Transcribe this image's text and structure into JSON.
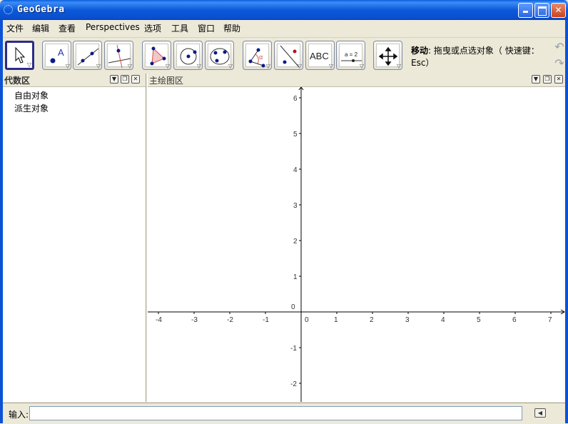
{
  "window": {
    "title": "GeoGebra",
    "buttons": {
      "minimize": "_",
      "maximize": "□",
      "close": "✕"
    }
  },
  "menu": [
    "文件",
    "编辑",
    "查看",
    "Perspectives",
    "选项",
    "工具",
    "窗口",
    "帮助"
  ],
  "toolbar": {
    "tools": [
      {
        "name": "move-tool",
        "selected": true
      },
      {
        "name": "new-point-tool",
        "label": "A"
      },
      {
        "name": "line-through-two-points-tool"
      },
      {
        "name": "perpendicular-line-tool"
      },
      {
        "name": "polygon-tool"
      },
      {
        "name": "circle-center-point-tool"
      },
      {
        "name": "conic-through-five-points-tool"
      },
      {
        "name": "angle-tool",
        "label": "α"
      },
      {
        "name": "reflect-about-line-tool"
      },
      {
        "name": "insert-text-tool",
        "label": "ABC"
      },
      {
        "name": "slider-tool",
        "label": "a = 2"
      },
      {
        "name": "move-graphics-view-tool"
      }
    ],
    "help_bold": "移动",
    "help_text": ": 拖曳或点选对象（ 快速键：Esc）"
  },
  "algebra_view": {
    "title": "代数区",
    "items": [
      "自由对象",
      "派生对象"
    ]
  },
  "graphics_view": {
    "title": "主绘图区",
    "x_ticks": [
      "-4",
      "-3",
      "-2",
      "-1",
      "0",
      "1",
      "2",
      "3",
      "4",
      "5",
      "6",
      "7"
    ],
    "y_ticks": [
      "6",
      "5",
      "4",
      "3",
      "2",
      "1",
      "0",
      "-1",
      "-2"
    ],
    "origin_label": "0"
  },
  "input_bar": {
    "label": "输入:",
    "value": ""
  }
}
